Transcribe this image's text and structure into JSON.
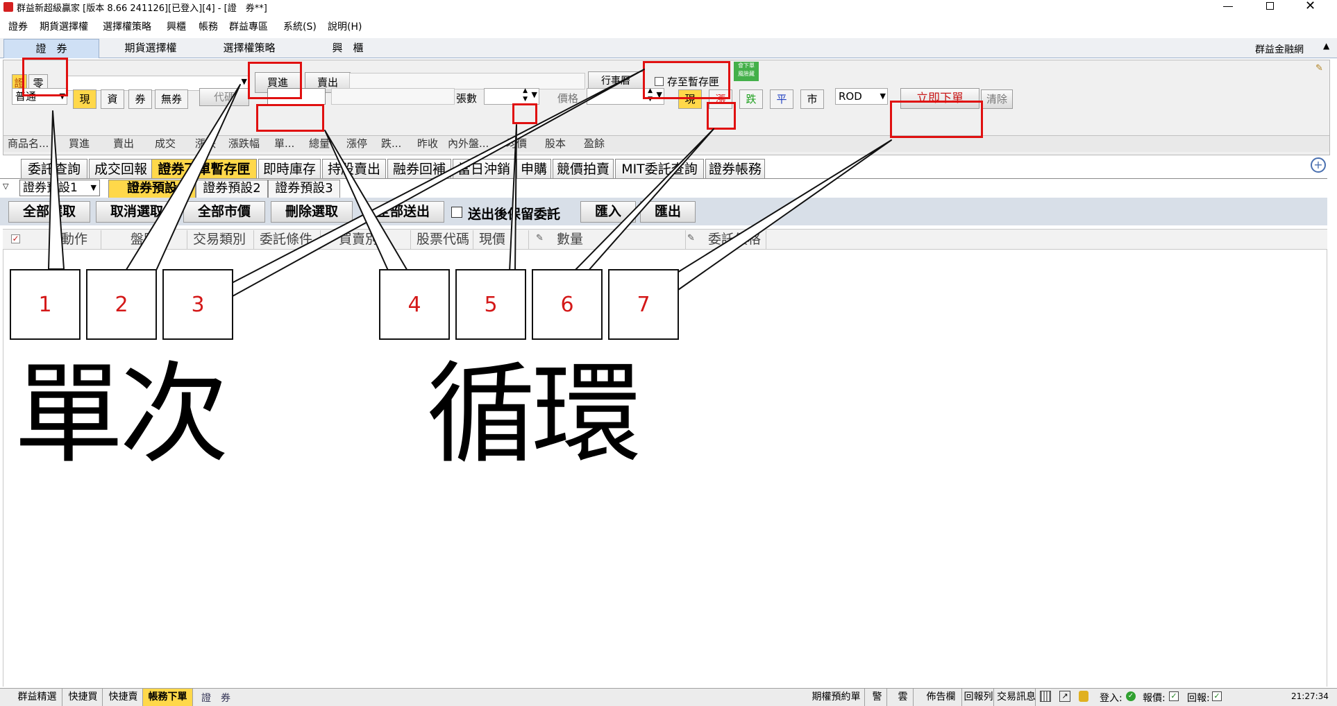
{
  "titlebar": {
    "title": "群益新超級贏家 [版本 8.66 241126][已登入][4] - [證　券**]"
  },
  "menubar": [
    "證券",
    "期貨選擇權",
    "選擇權策略",
    "興櫃",
    "帳務",
    "群益專區",
    "系統(S)",
    "說明(H)"
  ],
  "main_tabs": [
    "證　券",
    "期貨選擇權",
    "選擇權策略",
    "興　櫃"
  ],
  "right_link": "群益金融網",
  "order_row1": {
    "type_btn1": "證",
    "type_btn2": "零",
    "buy": "買進",
    "sell": "賣出",
    "calendar": "行事曆",
    "save_temp_label": "存至暫存匣",
    "badge_line1": "會下單",
    "badge_line2": "風險藏"
  },
  "order_row2": {
    "order_kind": "普通",
    "cash": "現",
    "margin": "資",
    "short": "券",
    "no_short": "無券",
    "code_label": "代碼",
    "qty_label": "張數",
    "price_label": "價格",
    "price_cash": "現",
    "price_up": "漲",
    "price_down": "跌",
    "price_flat": "平",
    "price_market": "市",
    "tif": "ROD",
    "submit": "立即下單",
    "clear": "清除"
  },
  "quote_header": [
    "商品名...",
    "買進",
    "賣出",
    "成交",
    "漲跌",
    "漲跌幅",
    "單...",
    "總量",
    "漲停",
    "跌...",
    "昨收",
    "內外盤...",
    "均價",
    "股本",
    "盈餘"
  ],
  "function_tabs": [
    "委託查詢",
    "成交回報",
    "證券下單暫存匣",
    "即時庫存",
    "持股賣出",
    "融券回補",
    "當日沖銷",
    "申購",
    "競價拍賣",
    "MIT委託查詢",
    "證券帳務"
  ],
  "preset": {
    "selector": "證券預設1",
    "tabs": [
      "證券預設",
      "證券預設2",
      "證券預設3"
    ]
  },
  "actions": {
    "select_all": "全部選取",
    "deselect": "取消選取",
    "all_market": "全部市價",
    "delete_sel": "刪除選取",
    "send_all": "全部送出",
    "keep_label": "送出後保留委託",
    "import": "匯入",
    "export": "匯出"
  },
  "columns": [
    "動作",
    "盤別",
    "交易類別",
    "委託條件",
    "買賣別",
    "股票代碼",
    "現價",
    "數量",
    "委託價格"
  ],
  "callouts": [
    "1",
    "2",
    "3",
    "4",
    "5",
    "6",
    "7"
  ],
  "big_labels": {
    "single": "單次",
    "cycle": "循環"
  },
  "statusbar": {
    "left_tabs": [
      "群益精選",
      "快捷買",
      "快捷賣",
      "帳務下單"
    ],
    "current": "證　券",
    "items": [
      "期權預約單",
      "警",
      "雲",
      "佈告欄",
      "回報列",
      "交易訊息"
    ],
    "login_label": "登入:",
    "report_label": "報價:",
    "reply_label": "回報:",
    "time": "21:27:34"
  },
  "colors": {
    "highlight_yellow": "#ffd84a",
    "annotation_red": "#e01010",
    "tab_active": "#cfe0f5"
  }
}
